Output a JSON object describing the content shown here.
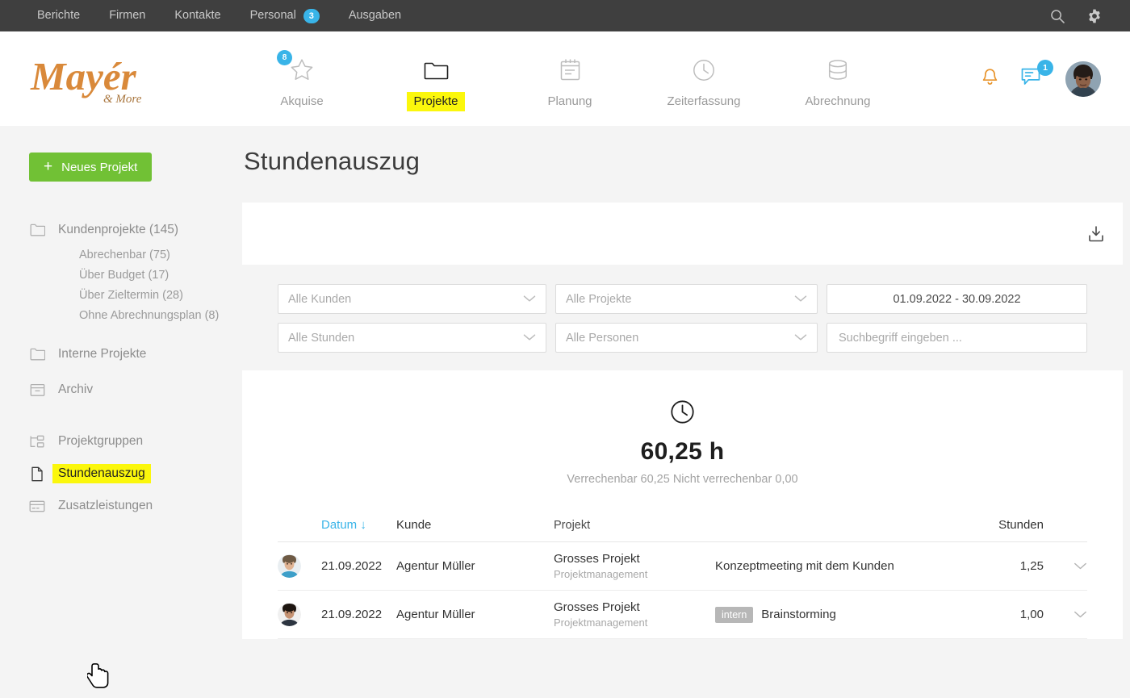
{
  "topbar": {
    "items": [
      {
        "label": "Berichte",
        "badge": null
      },
      {
        "label": "Firmen",
        "badge": null
      },
      {
        "label": "Kontakte",
        "badge": null
      },
      {
        "label": "Personal",
        "badge": "3"
      },
      {
        "label": "Ausgaben",
        "badge": null
      }
    ],
    "icons": [
      "search-icon",
      "gear-icon"
    ]
  },
  "header": {
    "logo_text": "Mayér",
    "logo_sub": "& More",
    "nav": [
      {
        "label": "Akquise",
        "icon": "star-icon",
        "badge": "8",
        "active": false
      },
      {
        "label": "Projekte",
        "icon": "folder-icon",
        "badge": null,
        "active": true
      },
      {
        "label": "Planung",
        "icon": "calendar-icon",
        "badge": null,
        "active": false
      },
      {
        "label": "Zeiterfassung",
        "icon": "clock-icon",
        "badge": null,
        "active": false
      },
      {
        "label": "Abrechnung",
        "icon": "database-icon",
        "badge": null,
        "active": false
      }
    ],
    "notification_icon": "bell-icon",
    "chat_icon": "chat-icon",
    "chat_badge": "1",
    "avatar": "user-avatar"
  },
  "sidebar": {
    "new_project_button": "Neues Projekt",
    "new_project_plus": "+",
    "items": [
      {
        "label": "Kundenprojekte (145)",
        "icon": "folder-icon",
        "highlight": false
      },
      {
        "label": "Interne Projekte",
        "icon": "folder-icon",
        "highlight": false
      },
      {
        "label": "Archiv",
        "icon": "archive-icon",
        "highlight": false
      },
      {
        "label": "Projektgruppen",
        "icon": "project-groups-icon",
        "highlight": false
      },
      {
        "label": "Stundenauszug",
        "icon": "document-icon",
        "highlight": true
      },
      {
        "label": "Zusatzleistungen",
        "icon": "card-icon",
        "highlight": false
      }
    ],
    "subitems": [
      {
        "label": "Abrechenbar (75)"
      },
      {
        "label": "Über Budget (17)"
      },
      {
        "label": "Über Zieltermin (28)"
      },
      {
        "label": "Ohne Abrechnungsplan (8)"
      }
    ]
  },
  "main": {
    "title": "Stundenauszug",
    "export_icon": "download-icon",
    "filters": {
      "kunden": "Alle Kunden",
      "projekte": "Alle Projekte",
      "daterange": "01.09.2022 - 30.09.2022",
      "stunden": "Alle Stunden",
      "personen": "Alle Personen",
      "search_placeholder": "Suchbegriff eingeben ...",
      "search_value": ""
    },
    "summary": {
      "icon": "clock-icon",
      "hours": "60,25 h",
      "detail": "Verrechenbar 60,25 Nicht verrechenbar 0,00"
    },
    "table": {
      "headers": {
        "datum": "Datum",
        "sort_arrow": "↓",
        "kunde": "Kunde",
        "projekt": "Projekt",
        "stunden": "Stunden"
      },
      "rows": [
        {
          "date": "21.09.2022",
          "kunde": "Agentur Müller",
          "projekt": "Grosses Projekt",
          "projekt_sub": "Projektmanagement",
          "tag": "",
          "beschreibung": "Konzeptmeeting mit dem Kunden",
          "stunden": "1,25"
        },
        {
          "date": "21.09.2022",
          "kunde": "Agentur Müller",
          "projekt": "Grosses Projekt",
          "projekt_sub": "Projektmanagement",
          "tag": "intern",
          "beschreibung": "Brainstorming",
          "stunden": "1,00"
        }
      ]
    }
  },
  "colors": {
    "accent_blue": "#39b4e8",
    "highlight_yellow": "#fbf70c",
    "green": "#71c135",
    "topbar": "#3f3f3f",
    "logo_orange": "#d98b3a"
  }
}
